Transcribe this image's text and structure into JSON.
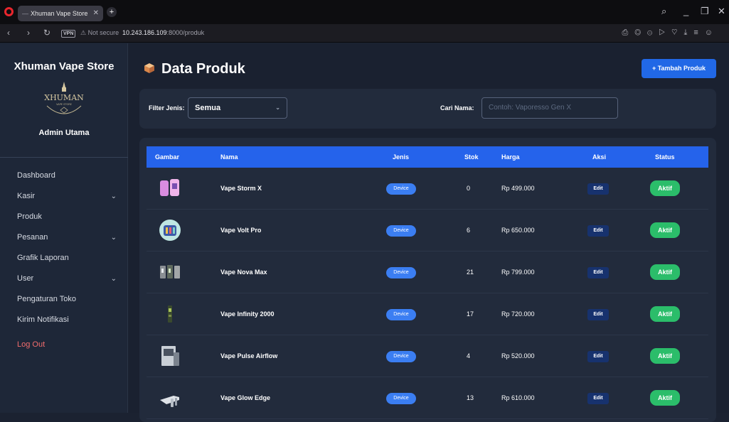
{
  "browser": {
    "tab_title": "Xhuman Vape Store",
    "tab_favicon": "—",
    "new_tab": "+",
    "not_secure": "⚠ Not secure",
    "vpn": "VPN",
    "url_host": "10.243.186.109",
    "url_path": ":8000/produk",
    "toolbar_icons": "⎙◎⊝▷♡⤓≡☺",
    "window_controls": [
      "search-icon",
      "minimize-icon",
      "restore-icon",
      "close-icon"
    ]
  },
  "sidebar": {
    "brand": "Xhuman Vape Store",
    "logo_text": "XHUMAN",
    "logo_subtext": "VAPE STORE",
    "admin_name": "Admin Utama",
    "items": [
      {
        "label": "Dashboard",
        "has_submenu": false
      },
      {
        "label": "Kasir",
        "has_submenu": true
      },
      {
        "label": "Produk",
        "has_submenu": false
      },
      {
        "label": "Pesanan",
        "has_submenu": true
      },
      {
        "label": "Grafik Laporan",
        "has_submenu": false
      },
      {
        "label": "User",
        "has_submenu": true
      },
      {
        "label": "Pengaturan Toko",
        "has_submenu": false
      },
      {
        "label": "Kirim Notifikasi",
        "has_submenu": false
      }
    ],
    "logout": "Log Out"
  },
  "header": {
    "title": "Data Produk",
    "add_button": "+ Tambah Produk"
  },
  "filter": {
    "type_label": "Filter Jenis:",
    "type_value": "Semua",
    "search_label": "Cari Nama:",
    "search_placeholder": "Contoh: Vaporesso Gen X"
  },
  "table": {
    "columns": [
      "Gambar",
      "Nama",
      "Jenis",
      "Stok",
      "Harga",
      "Aksi",
      "Status"
    ],
    "rows": [
      {
        "name": "Vape Storm X",
        "type": "Device",
        "stock": "0",
        "price": "Rp 499.000",
        "action": "Edit",
        "status": "Aktif"
      },
      {
        "name": "Vape Volt Pro",
        "type": "Device",
        "stock": "6",
        "price": "Rp 650.000",
        "action": "Edit",
        "status": "Aktif"
      },
      {
        "name": "Vape Nova Max",
        "type": "Device",
        "stock": "21",
        "price": "Rp 799.000",
        "action": "Edit",
        "status": "Aktif"
      },
      {
        "name": "Vape Infinity 2000",
        "type": "Device",
        "stock": "17",
        "price": "Rp 720.000",
        "action": "Edit",
        "status": "Aktif"
      },
      {
        "name": "Vape Pulse Airflow",
        "type": "Device",
        "stock": "4",
        "price": "Rp 520.000",
        "action": "Edit",
        "status": "Aktif"
      },
      {
        "name": "Vape Glow Edge",
        "type": "Device",
        "stock": "13",
        "price": "Rp 610.000",
        "action": "Edit",
        "status": "Aktif"
      }
    ]
  },
  "colors": {
    "primary": "#2563eb",
    "active": "#2bbd6a",
    "logout": "#f26d6d",
    "background": "#1a2130"
  }
}
